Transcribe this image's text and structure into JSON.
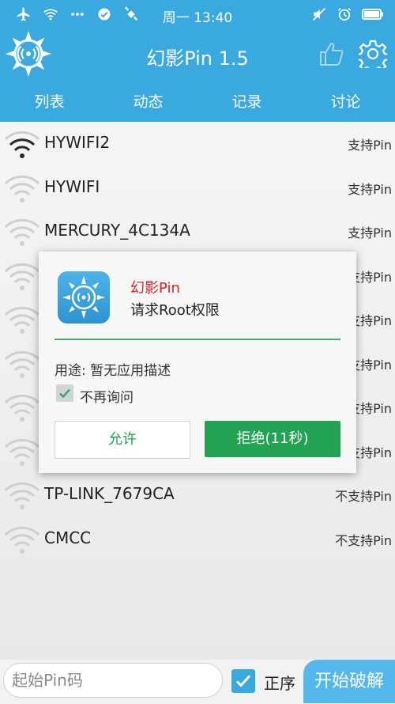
{
  "status_bar": {
    "time": "周一 13:40",
    "left_icons": [
      "airplane-icon",
      "wifi-icon",
      "more-icon",
      "check-circle-icon",
      "satellite-icon"
    ],
    "right_icons": [
      "mute-icon",
      "alarm-icon",
      "battery-icon"
    ]
  },
  "app_bar": {
    "title": "幻影Pin 1.5",
    "accent_color": "#3aa9e0"
  },
  "tabs": [
    {
      "label": "列表"
    },
    {
      "label": "动态"
    },
    {
      "label": "记录"
    },
    {
      "label": "讨论"
    }
  ],
  "networks": [
    {
      "ssid": "HYWIFI2",
      "support": "支持Pin"
    },
    {
      "ssid": "HYWIFI",
      "support": "支持Pin"
    },
    {
      "ssid": "MERCURY_4C134A",
      "support": "支持Pin"
    },
    {
      "ssid": "",
      "support": "支持Pin"
    },
    {
      "ssid": "",
      "support": "支持Pin"
    },
    {
      "ssid": "",
      "support": "支持Pin"
    },
    {
      "ssid": "",
      "support": "支持Pin"
    },
    {
      "ssid": "",
      "support": "支持Pin"
    },
    {
      "ssid": "TP-LINK_7679CA",
      "support": "不支持Pin"
    },
    {
      "ssid": "CMCC",
      "support": "不支持Pin"
    }
  ],
  "dialog": {
    "app_name": "幻影Pin",
    "request": "请求Root权限",
    "purpose": "用途: 暂无应用描述",
    "dont_ask_label": "不再询问",
    "dont_ask_checked": true,
    "allow_label": "允许",
    "deny_label": "拒绝(11秒)",
    "deny_color": "#22a354"
  },
  "bottom_bar": {
    "pin_placeholder": "起始Pin码",
    "pin_value": "",
    "order_label": "正序",
    "order_checked": true,
    "start_label": "开始破解"
  }
}
